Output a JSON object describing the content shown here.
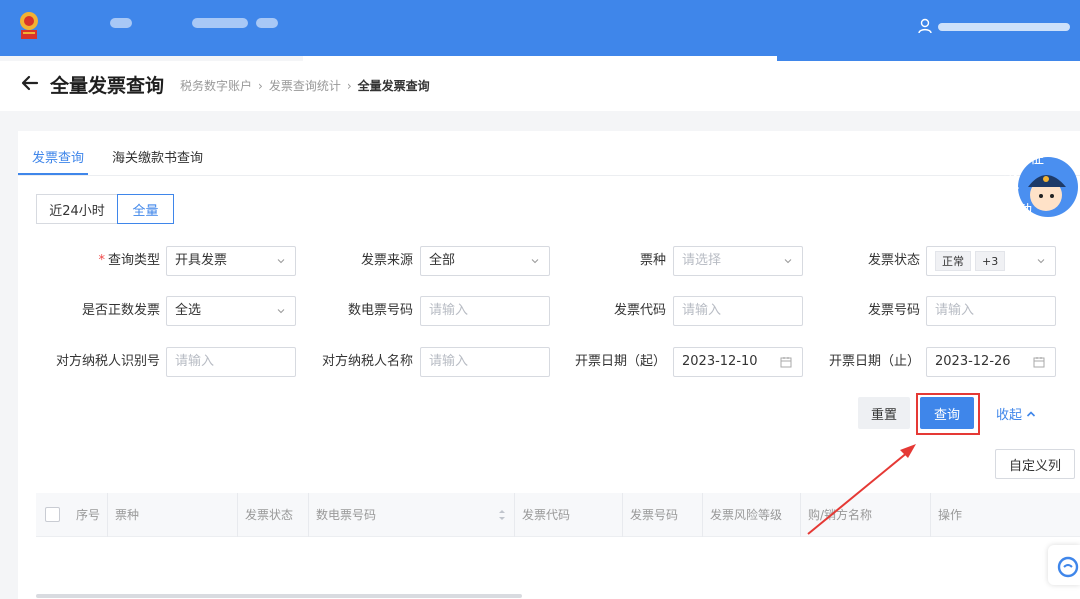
{
  "header": {
    "title": "全量发票查询",
    "breadcrumb": [
      "税务数字账户",
      "发票查询统计",
      "全量发票查询"
    ]
  },
  "tabs": [
    "发票查询",
    "海关缴款书查询"
  ],
  "range_toggle": [
    "近24小时",
    "全量"
  ],
  "form": {
    "query_type": {
      "label": "查询类型",
      "value": "开具发票"
    },
    "invoice_source": {
      "label": "发票来源",
      "value": "全部"
    },
    "ticket_type": {
      "label": "票种",
      "placeholder": "请选择"
    },
    "invoice_status": {
      "label": "发票状态",
      "tag": "正常",
      "extra": "+3"
    },
    "is_positive": {
      "label": "是否正数发票",
      "value": "全选"
    },
    "digital_number": {
      "label": "数电票号码",
      "placeholder": "请输入"
    },
    "invoice_code": {
      "label": "发票代码",
      "placeholder": "请输入"
    },
    "invoice_number": {
      "label": "发票号码",
      "placeholder": "请输入"
    },
    "counterparty_id": {
      "label": "对方纳税人识别号",
      "placeholder": "请输入"
    },
    "counterparty_name": {
      "label": "对方纳税人名称",
      "placeholder": "请输入"
    },
    "date_start": {
      "label": "开票日期（起）",
      "value": "2023-12-10"
    },
    "date_end": {
      "label": "开票日期（止）",
      "value": "2023-12-26"
    }
  },
  "actions": {
    "reset": "重置",
    "query": "查询",
    "collapse": "收起",
    "columns": "自定义列"
  },
  "table": {
    "columns": [
      "序号",
      "票种",
      "发票状态",
      "数电票号码",
      "发票代码",
      "发票号码",
      "发票风险等级",
      "购/销方名称",
      "操作"
    ]
  },
  "mascot": {
    "text": [
      "征",
      "纳",
      "互",
      "动"
    ]
  },
  "colors": {
    "primary": "#3f86ea",
    "highlight": "#e53935",
    "topbar": "#3f86ea"
  }
}
